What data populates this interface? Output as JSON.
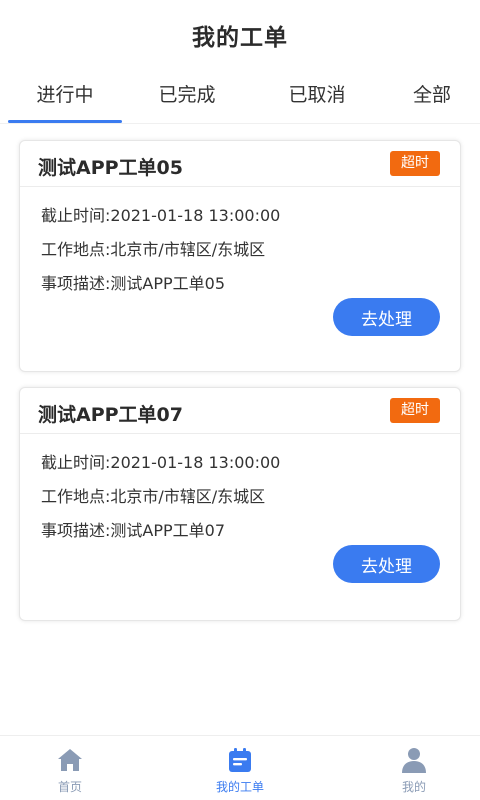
{
  "page": {
    "title": "我的工单"
  },
  "tabs": [
    {
      "label": "进行中"
    },
    {
      "label": "已完成"
    },
    {
      "label": "已取消"
    },
    {
      "label": "全部"
    }
  ],
  "orders": [
    {
      "title": "测试APP工单05",
      "badge": "超时",
      "deadline": "截止时间:2021-01-18 13:00:00",
      "location": "工作地点:北京市/市辖区/东城区",
      "description": "事项描述:测试APP工单05",
      "action_label": "去处理"
    },
    {
      "title": "测试APP工单07",
      "badge": "超时",
      "deadline": "截止时间:2021-01-18 13:00:00",
      "location": "工作地点:北京市/市辖区/东城区",
      "description": "事项描述:测试APP工单07",
      "action_label": "去处理"
    }
  ],
  "bottom_nav": [
    {
      "label": "首页",
      "icon": "home-icon"
    },
    {
      "label": "我的工单",
      "icon": "work-order-icon"
    },
    {
      "label": "我的",
      "icon": "user-icon"
    }
  ],
  "colors": {
    "accent": "#3a7bf0",
    "badge": "#f26a10",
    "nav_inactive": "#8a9bb5"
  }
}
